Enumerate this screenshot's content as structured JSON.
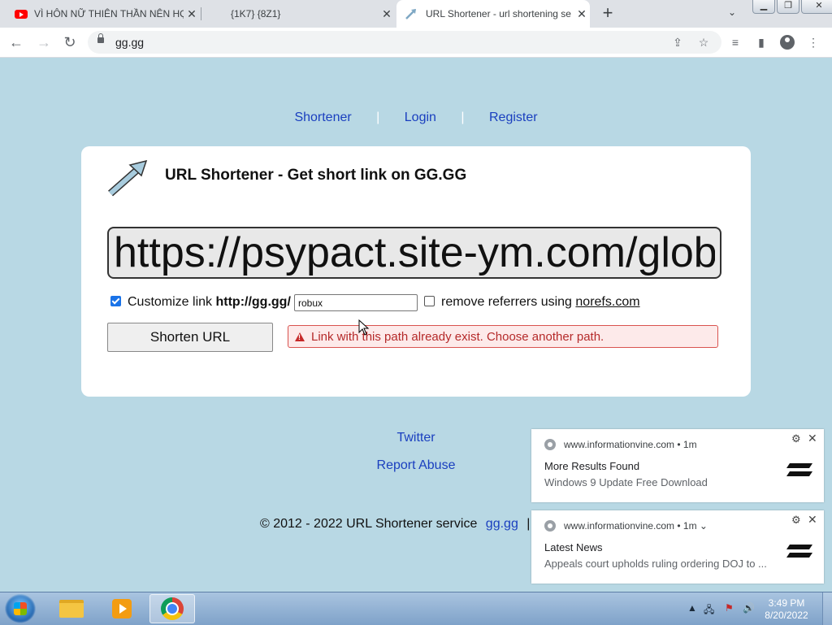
{
  "browser": {
    "tabs": [
      {
        "title": "VÌ HÔN NỮ THIÊN THẦN NÊN HỌ",
        "close": "✕"
      },
      {
        "title": "{1K7} {8Z1}",
        "close": "✕"
      },
      {
        "title": "URL Shortener - url shortening se",
        "close": "✕"
      }
    ],
    "new_tab": "+",
    "address": "gg.gg",
    "window_buttons": {
      "minimize": "▁",
      "maximize": "❐",
      "close": "✕"
    }
  },
  "page": {
    "nav": {
      "shortener": "Shortener",
      "login": "Login",
      "register": "Register",
      "separator": "|"
    },
    "title": "URL Shortener - Get short link on GG.GG",
    "long_url": "https://psypact.site-ym.com/glob",
    "customize": {
      "label": "Customize link",
      "prefix": "http://gg.gg/",
      "path_value": "robux",
      "checked": true
    },
    "norefs": {
      "label": "remove referrers using",
      "link": "norefs.com",
      "checked": false
    },
    "shorten_button": "Shorten URL",
    "error": "Link with this path already exist. Choose another path.",
    "footer": {
      "twitter": "Twitter",
      "report": "Report Abuse",
      "copyright": "© 2012 - 2022 URL Shortener service",
      "site_link": "gg.gg",
      "separator": "|"
    }
  },
  "notifications": [
    {
      "source": "www.informationvine.com • 1m",
      "title": "More Results Found",
      "body": "Windows 9 Update Free Download"
    },
    {
      "source": "www.informationvine.com • 1m ⌄",
      "title": "Latest News",
      "body": "Appeals court upholds ruling ordering DOJ to ..."
    }
  ],
  "taskbar": {
    "time": "3:49 PM",
    "date": "8/20/2022"
  },
  "colors": {
    "page_bg": "#b8d8e4",
    "link": "#1a3fbf",
    "error_text": "#b52a2a",
    "error_bg": "#fdeaea"
  }
}
